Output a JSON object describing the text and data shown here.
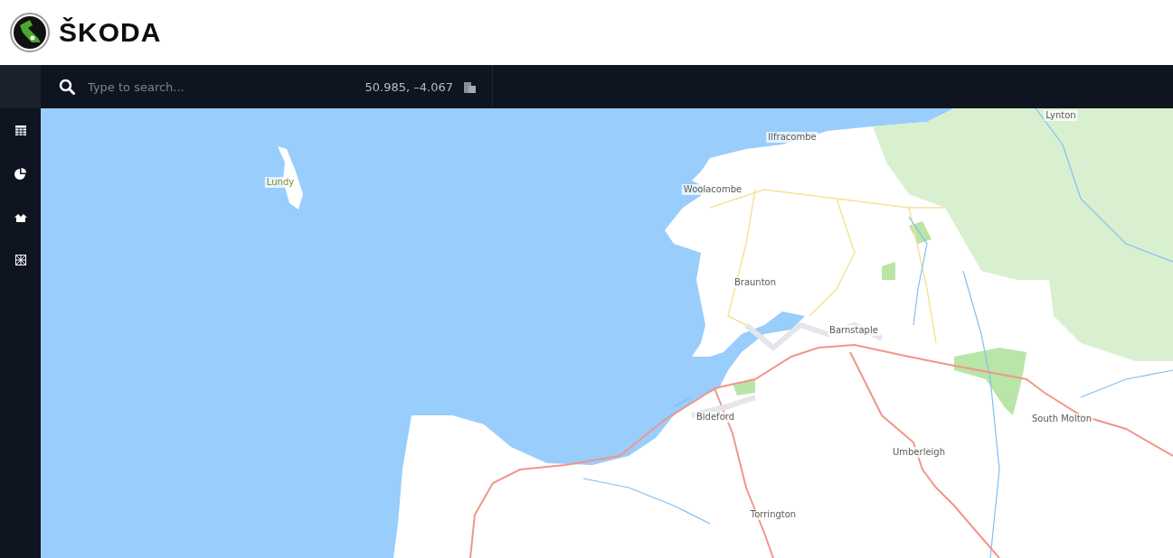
{
  "header": {
    "brand": "ŠKODA"
  },
  "toolbar": {
    "search": {
      "placeholder": "Type to search..."
    },
    "coordinates": "50.985, –4.067"
  },
  "sidebar": {
    "items": [
      {
        "kind": "table"
      },
      {
        "kind": "chart"
      },
      {
        "kind": "houses"
      },
      {
        "kind": "map"
      }
    ]
  },
  "map": {
    "places": [
      {
        "name": "Lynton"
      },
      {
        "name": "Ilfracombe"
      },
      {
        "name": "Woolacombe"
      },
      {
        "name": "Lundy"
      },
      {
        "name": "Braunton"
      },
      {
        "name": "Barnstaple"
      },
      {
        "name": "Bideford"
      },
      {
        "name": "South Molton"
      },
      {
        "name": "Umberleigh"
      },
      {
        "name": "Torrington"
      }
    ]
  }
}
